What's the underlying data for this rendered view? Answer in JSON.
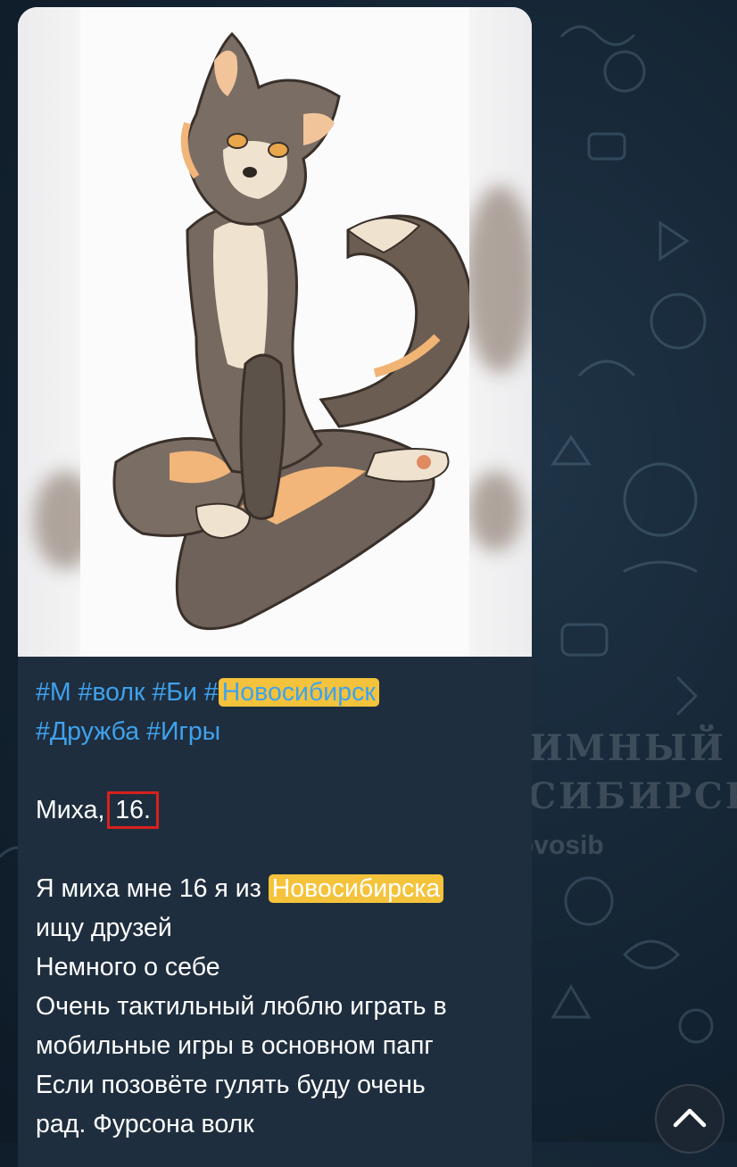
{
  "watermark": {
    "line1": "АНОНИМНЫЙ",
    "line2": "НОВОСИБИРСК",
    "handle": "anonnovosib"
  },
  "post": {
    "tags_line1": [
      {
        "text": "#М",
        "highlight": false
      },
      {
        "text": "#волк",
        "highlight": false
      },
      {
        "text": "#Би",
        "highlight": false
      }
    ],
    "tag_city_prefix": "#",
    "tag_city_highlighted": "Новосибирск",
    "tags_line2": [
      {
        "text": "#Дружба"
      },
      {
        "text": "#Игры"
      }
    ],
    "name_prefix": "Миха,",
    "age_boxed": "16.",
    "body_line1_prefix": "Я миха мне 16 я из",
    "body_line1_highlight": "Новосибирска",
    "body_lines": [
      "ищу друзей",
      "Немного о себе",
      "Очень тактильный люблю играть в",
      "мобильные игры в основном папг",
      "Если позовёте гулять буду очень",
      "рад. Фурсона волк"
    ]
  },
  "colors": {
    "link": "#3fa2ee",
    "highlight": "#f4c33b",
    "bubble": "#1f2e3e",
    "annotation_box": "#d8201c"
  },
  "icons": {
    "scroll": "chevron-up-icon",
    "telegram": "telegram-icon"
  }
}
